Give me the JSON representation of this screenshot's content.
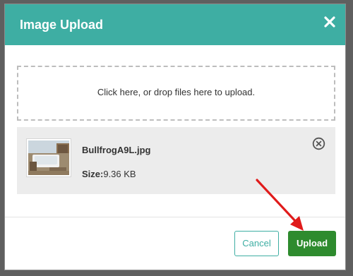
{
  "modal": {
    "title": "Image Upload"
  },
  "dropzone": {
    "text": "Click here, or drop files here to upload."
  },
  "file": {
    "name": "BullfrogA9L.jpg",
    "size_label": "Size:",
    "size_value": "9.36 KB"
  },
  "footer": {
    "cancel_label": "Cancel",
    "upload_label": "Upload"
  },
  "colors": {
    "header": "#3eaea3",
    "upload_button": "#2e8b2e",
    "annotation_arrow": "#e01b1b"
  },
  "icons": {
    "close": "close-icon",
    "remove": "remove-circle-icon"
  }
}
